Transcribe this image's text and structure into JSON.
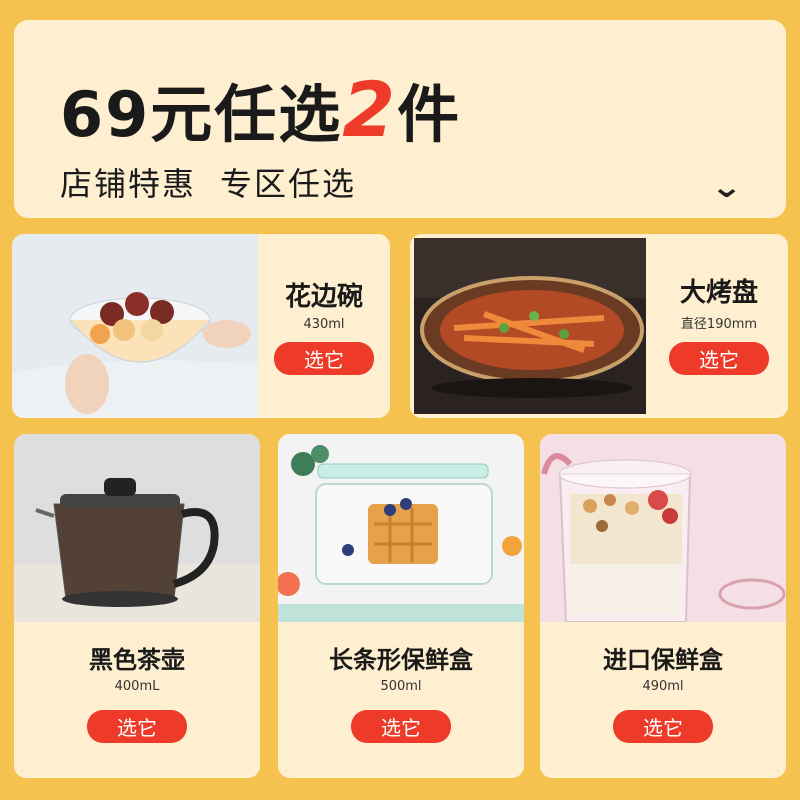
{
  "banner": {
    "price_text": "69元任选",
    "count": "2",
    "unit": "件",
    "subtitle_1": "店铺特惠",
    "subtitle_2": "专区任选",
    "chevron_glyph": "⌄"
  },
  "products": [
    {
      "name": "花边碗",
      "spec": "430ml",
      "button": "选它"
    },
    {
      "name": "大烤盘",
      "spec": "直径190mm",
      "button": "选它"
    },
    {
      "name": "黑色茶壶",
      "spec": "400mL",
      "button": "选它"
    },
    {
      "name": "长条形保鲜盒",
      "spec": "500ml",
      "button": "选它"
    },
    {
      "name": "进口保鲜盒",
      "spec": "490ml",
      "button": "选它"
    }
  ],
  "colors": {
    "background": "#f6c24f",
    "card": "#fdefcf",
    "accent": "#ee3a28"
  }
}
